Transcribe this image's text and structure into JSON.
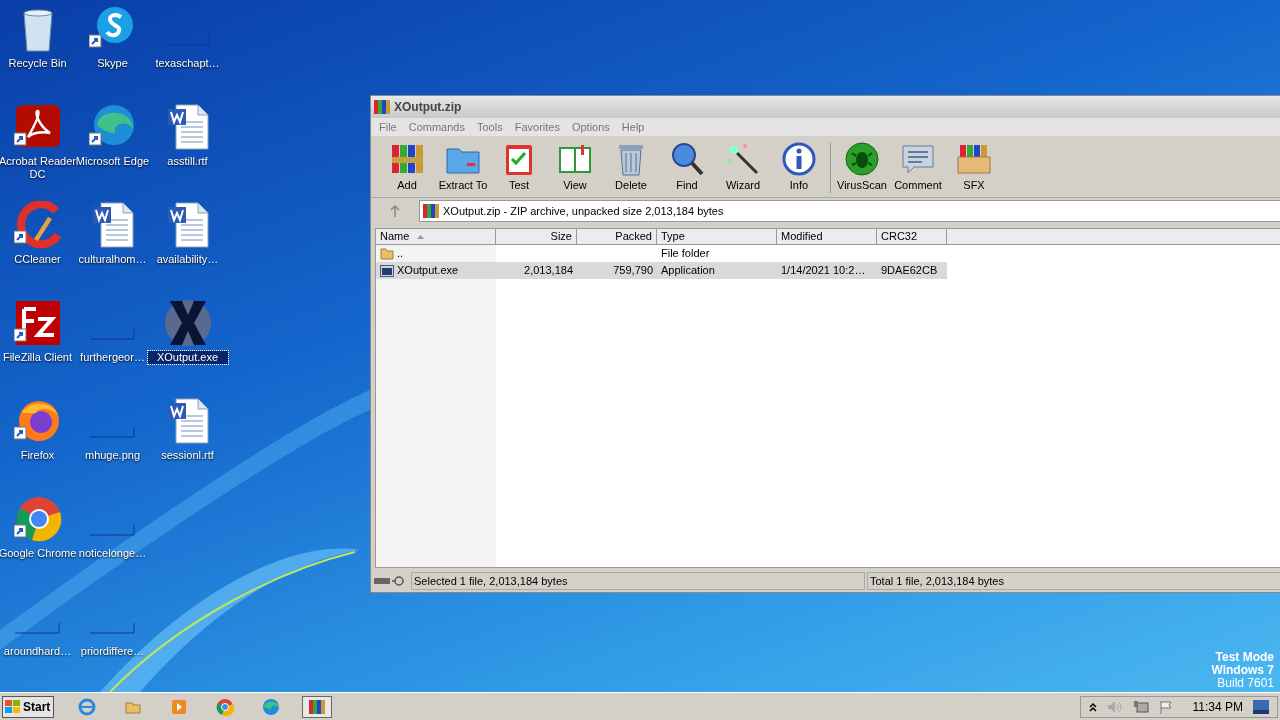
{
  "desktop": {
    "columns": [
      [
        {
          "label": "Recycle Bin",
          "kind": "recycle",
          "selected": false
        },
        {
          "label": "Acrobat Reader DC",
          "kind": "acrobat",
          "selected": false
        },
        {
          "label": "CCleaner",
          "kind": "ccleaner",
          "selected": false
        },
        {
          "label": "FileZilla Client",
          "kind": "filezilla",
          "selected": false
        },
        {
          "label": "Firefox",
          "kind": "firefox",
          "selected": false
        },
        {
          "label": "Google Chrome",
          "kind": "chrome",
          "selected": false
        },
        {
          "label": "aroundhard…",
          "kind": "blank",
          "selected": false
        }
      ],
      [
        {
          "label": "Skype",
          "kind": "skype",
          "selected": false
        },
        {
          "label": "Microsoft Edge",
          "kind": "edge",
          "selected": false
        },
        {
          "label": "culturalhom…",
          "kind": "word",
          "selected": false
        },
        {
          "label": "furthergeor…",
          "kind": "blank",
          "selected": false
        },
        {
          "label": "mhuge.png",
          "kind": "blank",
          "selected": false
        },
        {
          "label": "noticelonge…",
          "kind": "blank",
          "selected": false
        },
        {
          "label": "priordiffere…",
          "kind": "blank",
          "selected": false
        }
      ],
      [
        {
          "label": "texaschapt…",
          "kind": "blank",
          "selected": false
        },
        {
          "label": "asstill.rtf",
          "kind": "word",
          "selected": false
        },
        {
          "label": "availability…",
          "kind": "word",
          "selected": false
        },
        {
          "label": "XOutput.exe",
          "kind": "xoutput",
          "selected": true
        },
        {
          "label": "sessionl.rtf",
          "kind": "word",
          "selected": false
        }
      ]
    ]
  },
  "window": {
    "title": "XOutput.zip",
    "menu": [
      "File",
      "Commands",
      "Tools",
      "Favorites",
      "Options",
      "Help"
    ],
    "toolbar": [
      {
        "label": "Add",
        "kind": "add"
      },
      {
        "label": "Extract To",
        "kind": "extract"
      },
      {
        "label": "Test",
        "kind": "test"
      },
      {
        "label": "View",
        "kind": "view"
      },
      {
        "label": "Delete",
        "kind": "delete"
      },
      {
        "label": "Find",
        "kind": "find"
      },
      {
        "label": "Wizard",
        "kind": "wizard"
      },
      {
        "label": "Info",
        "kind": "info"
      },
      {
        "label": "VirusScan",
        "kind": "virus"
      },
      {
        "label": "Comment",
        "kind": "comment"
      },
      {
        "label": "SFX",
        "kind": "sfx"
      }
    ],
    "address": "XOutput.zip - ZIP archive, unpacked size 2,013,184 bytes",
    "table": {
      "columns": [
        {
          "label": "Name",
          "sorted": true
        },
        {
          "label": "Size",
          "sorted": false
        },
        {
          "label": "Packed",
          "sorted": false
        },
        {
          "label": "Type",
          "sorted": false
        },
        {
          "label": "Modified",
          "sorted": false
        },
        {
          "label": "CRC32",
          "sorted": false
        }
      ],
      "rows": [
        {
          "kind": "folder",
          "selected": false,
          "cells": [
            "..",
            "",
            "",
            "File folder",
            "",
            ""
          ]
        },
        {
          "kind": "exe",
          "selected": true,
          "cells": [
            "XOutput.exe",
            "2,013,184",
            "759,790",
            "Application",
            "1/14/2021 10:2…",
            "9DAE62CB"
          ]
        }
      ]
    },
    "status_bar": [
      "Selected 1 file, 2,013,184 bytes",
      "Total 1 file, 2,013,184 bytes"
    ]
  },
  "watermark_text": [
    "Test Mode",
    "Windows 7",
    "Build 7601"
  ],
  "taskbar": {
    "start": "Start",
    "apps": [
      {
        "kind": "ie",
        "selected": false
      },
      {
        "kind": "explorer",
        "selected": false
      },
      {
        "kind": "media",
        "selected": false
      },
      {
        "kind": "chrome",
        "selected": false
      },
      {
        "kind": "edge",
        "selected": false
      },
      {
        "kind": "winrar",
        "selected": true
      }
    ],
    "clock": "11:34 PM"
  }
}
